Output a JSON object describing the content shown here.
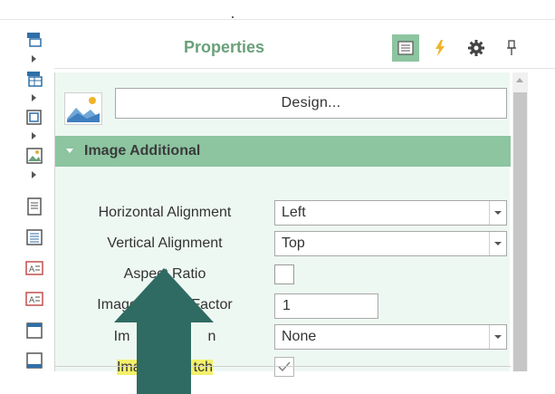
{
  "panel": {
    "title": "Properties",
    "header_buttons": [
      "properties-icon",
      "events-icon",
      "gear-icon",
      "pin-icon"
    ]
  },
  "design_button": {
    "label": "Design..."
  },
  "section": {
    "title": "Image Additional",
    "expanded": true
  },
  "properties": {
    "horizontal_alignment": {
      "label": "Horizontal Alignment",
      "value": "Left"
    },
    "vertical_alignment": {
      "label": "Vertical Alignment",
      "value": "Top"
    },
    "aspect_ratio": {
      "label": "Aspect Ratio",
      "checked": false
    },
    "image_multiple_factor": {
      "label_left": "Image Mu",
      "label_right": "le Factor",
      "value": "1"
    },
    "image_align": {
      "label_left": "Im",
      "label_right": "n",
      "value": "None"
    },
    "image_stretch": {
      "label_left": "Ima",
      "label_right": "tch",
      "checked": true
    }
  },
  "colors": {
    "accent": "#8cc5a0",
    "title_green": "#6aa07a",
    "panel_bg": "#eef8f2",
    "highlight": "#f3f06a",
    "arrow": "#2f6b62"
  }
}
